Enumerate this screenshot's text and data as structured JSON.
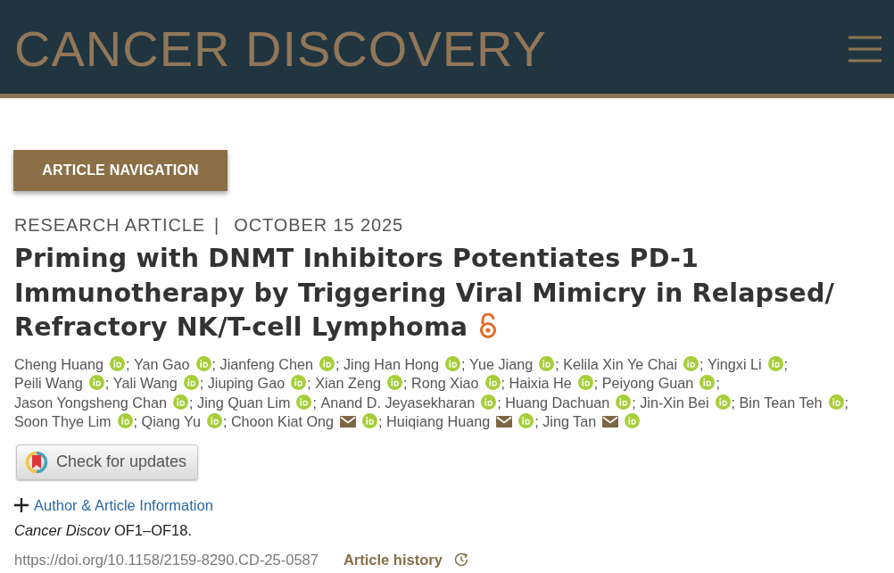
{
  "header": {
    "logo": "CANCER DISCOVERY"
  },
  "article_navigation": {
    "label": "ARTICLE NAVIGATION"
  },
  "article_meta": {
    "category": "RESEARCH ARTICLE",
    "separator": "|",
    "date": "OCTOBER 15 2025"
  },
  "article": {
    "title": "Priming with DNMT Inhibitors Potentiates PD-1 Immunotherapy by Triggering Viral Mimicry in Relapsed/Refractory NK/T-cell Lymphoma",
    "open_access": true
  },
  "authors": {
    "separator": ";",
    "list": [
      {
        "name": "Cheng Huang",
        "email": false,
        "orcid": true
      },
      {
        "name": "Yan Gao",
        "email": false,
        "orcid": true
      },
      {
        "name": "Jianfeng Chen",
        "email": false,
        "orcid": true
      },
      {
        "name": "Jing Han Hong",
        "email": false,
        "orcid": true
      },
      {
        "name": "Yue Jiang",
        "email": false,
        "orcid": true
      },
      {
        "name": "Kelila Xin Ye Chai",
        "email": false,
        "orcid": true
      },
      {
        "name": "Yingxi Li",
        "email": false,
        "orcid": true
      },
      {
        "name": "Peili Wang",
        "email": false,
        "orcid": true
      },
      {
        "name": "Yali Wang",
        "email": false,
        "orcid": true
      },
      {
        "name": "Jiuping Gao",
        "email": false,
        "orcid": true
      },
      {
        "name": "Xian Zeng",
        "email": false,
        "orcid": true
      },
      {
        "name": "Rong Xiao",
        "email": false,
        "orcid": true
      },
      {
        "name": "Haixia He",
        "email": false,
        "orcid": true
      },
      {
        "name": "Peiyong Guan",
        "email": false,
        "orcid": true
      },
      {
        "name": "Jason Yongsheng Chan",
        "email": false,
        "orcid": true
      },
      {
        "name": "Jing Quan Lim",
        "email": false,
        "orcid": true
      },
      {
        "name": "Anand D. Jeyasekharan",
        "email": false,
        "orcid": true
      },
      {
        "name": "Huang Dachuan",
        "email": false,
        "orcid": true
      },
      {
        "name": "Jin-Xin Bei",
        "email": false,
        "orcid": true
      },
      {
        "name": "Bin Tean Teh",
        "email": false,
        "orcid": true
      },
      {
        "name": "Soon Thye Lim",
        "email": false,
        "orcid": true
      },
      {
        "name": "Qiang Yu",
        "email": false,
        "orcid": true
      },
      {
        "name": "Choon Kiat Ong",
        "email": true,
        "orcid": true
      },
      {
        "name": "Huiqiang Huang",
        "email": true,
        "orcid": true
      },
      {
        "name": "Jing Tan",
        "email": true,
        "orcid": true
      }
    ]
  },
  "check_for_updates": {
    "label": "Check for updates"
  },
  "author_info": {
    "label": "Author & Article Information",
    "expanded": false
  },
  "citation": "*Cancer Discov* OF1–OF18.",
  "doi": "https://doi.org/10.1158/2159-8290.CD-25-0587",
  "article_history": {
    "label": "Article history"
  }
}
